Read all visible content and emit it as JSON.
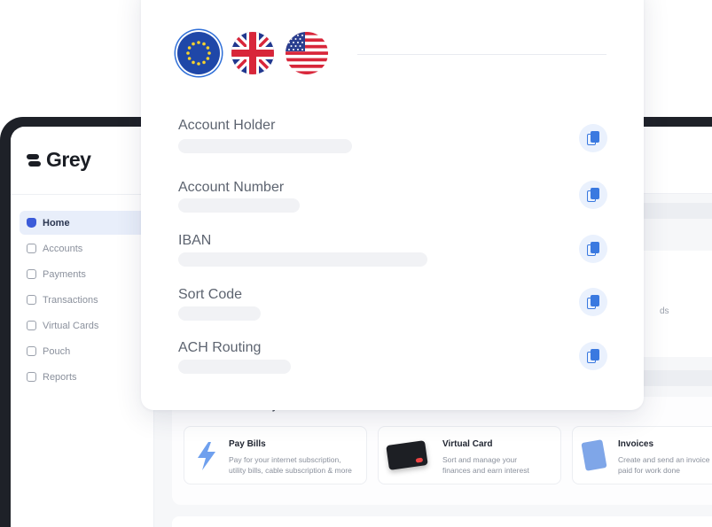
{
  "app": {
    "brand": "Grey",
    "nav": [
      {
        "label": "Home",
        "active": true
      },
      {
        "label": "Accounts"
      },
      {
        "label": "Payments"
      },
      {
        "label": "Transactions"
      },
      {
        "label": "Virtual Cards"
      },
      {
        "label": "Pouch"
      },
      {
        "label": "Reports"
      }
    ],
    "panel_fragment": "ds",
    "recommended_title": "Recommended for you",
    "recommendations": [
      {
        "title": "Pay Bills",
        "description": "Pay for your internet subscription,\nutility bills, cable subscription & more"
      },
      {
        "title": "Virtual Card",
        "description": "Sort and manage your\nfinances and earn interest"
      },
      {
        "title": "Invoices",
        "description": "Create and send an invoice\npaid for work done"
      }
    ]
  },
  "details_card": {
    "currencies": [
      {
        "name": "EU",
        "icon": "eu-flag-icon",
        "selected": true
      },
      {
        "name": "UK",
        "icon": "uk-flag-icon"
      },
      {
        "name": "US",
        "icon": "us-flag-icon"
      }
    ],
    "fields": [
      {
        "label": "Account Holder"
      },
      {
        "label": "Account Number"
      },
      {
        "label": "IBAN"
      },
      {
        "label": "Sort Code"
      },
      {
        "label": "ACH Routing"
      }
    ]
  },
  "colors": {
    "accent": "#3a79e0",
    "accent_soft": "#eaf1fd",
    "frame": "#1e2128",
    "placeholder": "#f1f2f5"
  }
}
